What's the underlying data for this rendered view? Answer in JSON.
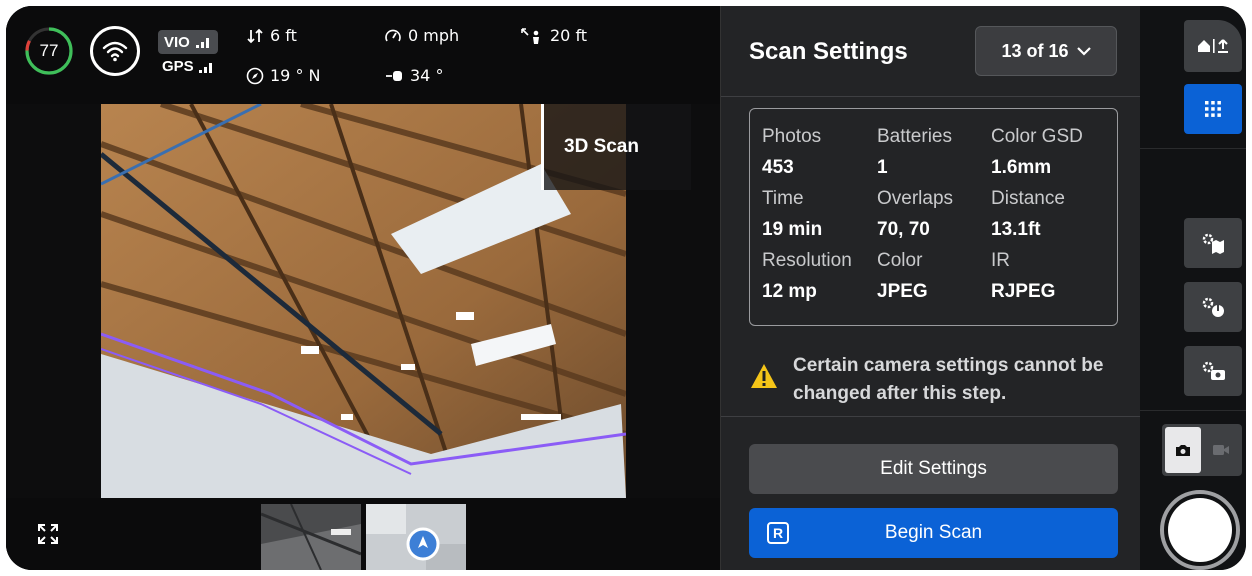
{
  "status": {
    "battery_percent": "77",
    "vio_label": "VIO",
    "gps_label": "GPS",
    "altitude": "6 ft",
    "heading": "19 ° N",
    "speed": "0 mph",
    "gimbal_angle": "34 °",
    "distance_to_home": "20 ft"
  },
  "camera_view": {
    "mode_label": "3D Scan"
  },
  "panel": {
    "title": "Scan Settings",
    "step": "13 of 16",
    "summary": [
      {
        "label": "Photos",
        "value": "453"
      },
      {
        "label": "Batteries",
        "value": "1"
      },
      {
        "label": "Color GSD",
        "value": "1.6mm"
      },
      {
        "label": "Time",
        "value": "19 min"
      },
      {
        "label": "Overlaps",
        "value": "70, 70"
      },
      {
        "label": "Distance",
        "value": "13.1ft"
      },
      {
        "label": "Resolution",
        "value": "12 mp"
      },
      {
        "label": "Color",
        "value": "JPEG"
      },
      {
        "label": "IR",
        "value": "RJPEG"
      }
    ],
    "warning": "Certain camera settings cannot be changed after this step.",
    "edit_button": "Edit Settings",
    "begin_button": "Begin Scan",
    "begin_key": "R"
  },
  "colors": {
    "accent_blue": "#0b62d6",
    "panel_bg": "#232426",
    "warning_yellow": "#f5c518",
    "battery_green": "#3fbf5a"
  },
  "icons": [
    "wifi-icon",
    "altitude-icon",
    "compass-icon",
    "speedometer-icon",
    "gimbal-icon",
    "home-distance-icon",
    "expand-icon",
    "chevron-down-icon",
    "warning-icon",
    "home-return-icon",
    "grid-icon",
    "settings-map-icon",
    "settings-obstacle-icon",
    "settings-camera-icon",
    "photo-mode-icon",
    "video-mode-icon"
  ]
}
